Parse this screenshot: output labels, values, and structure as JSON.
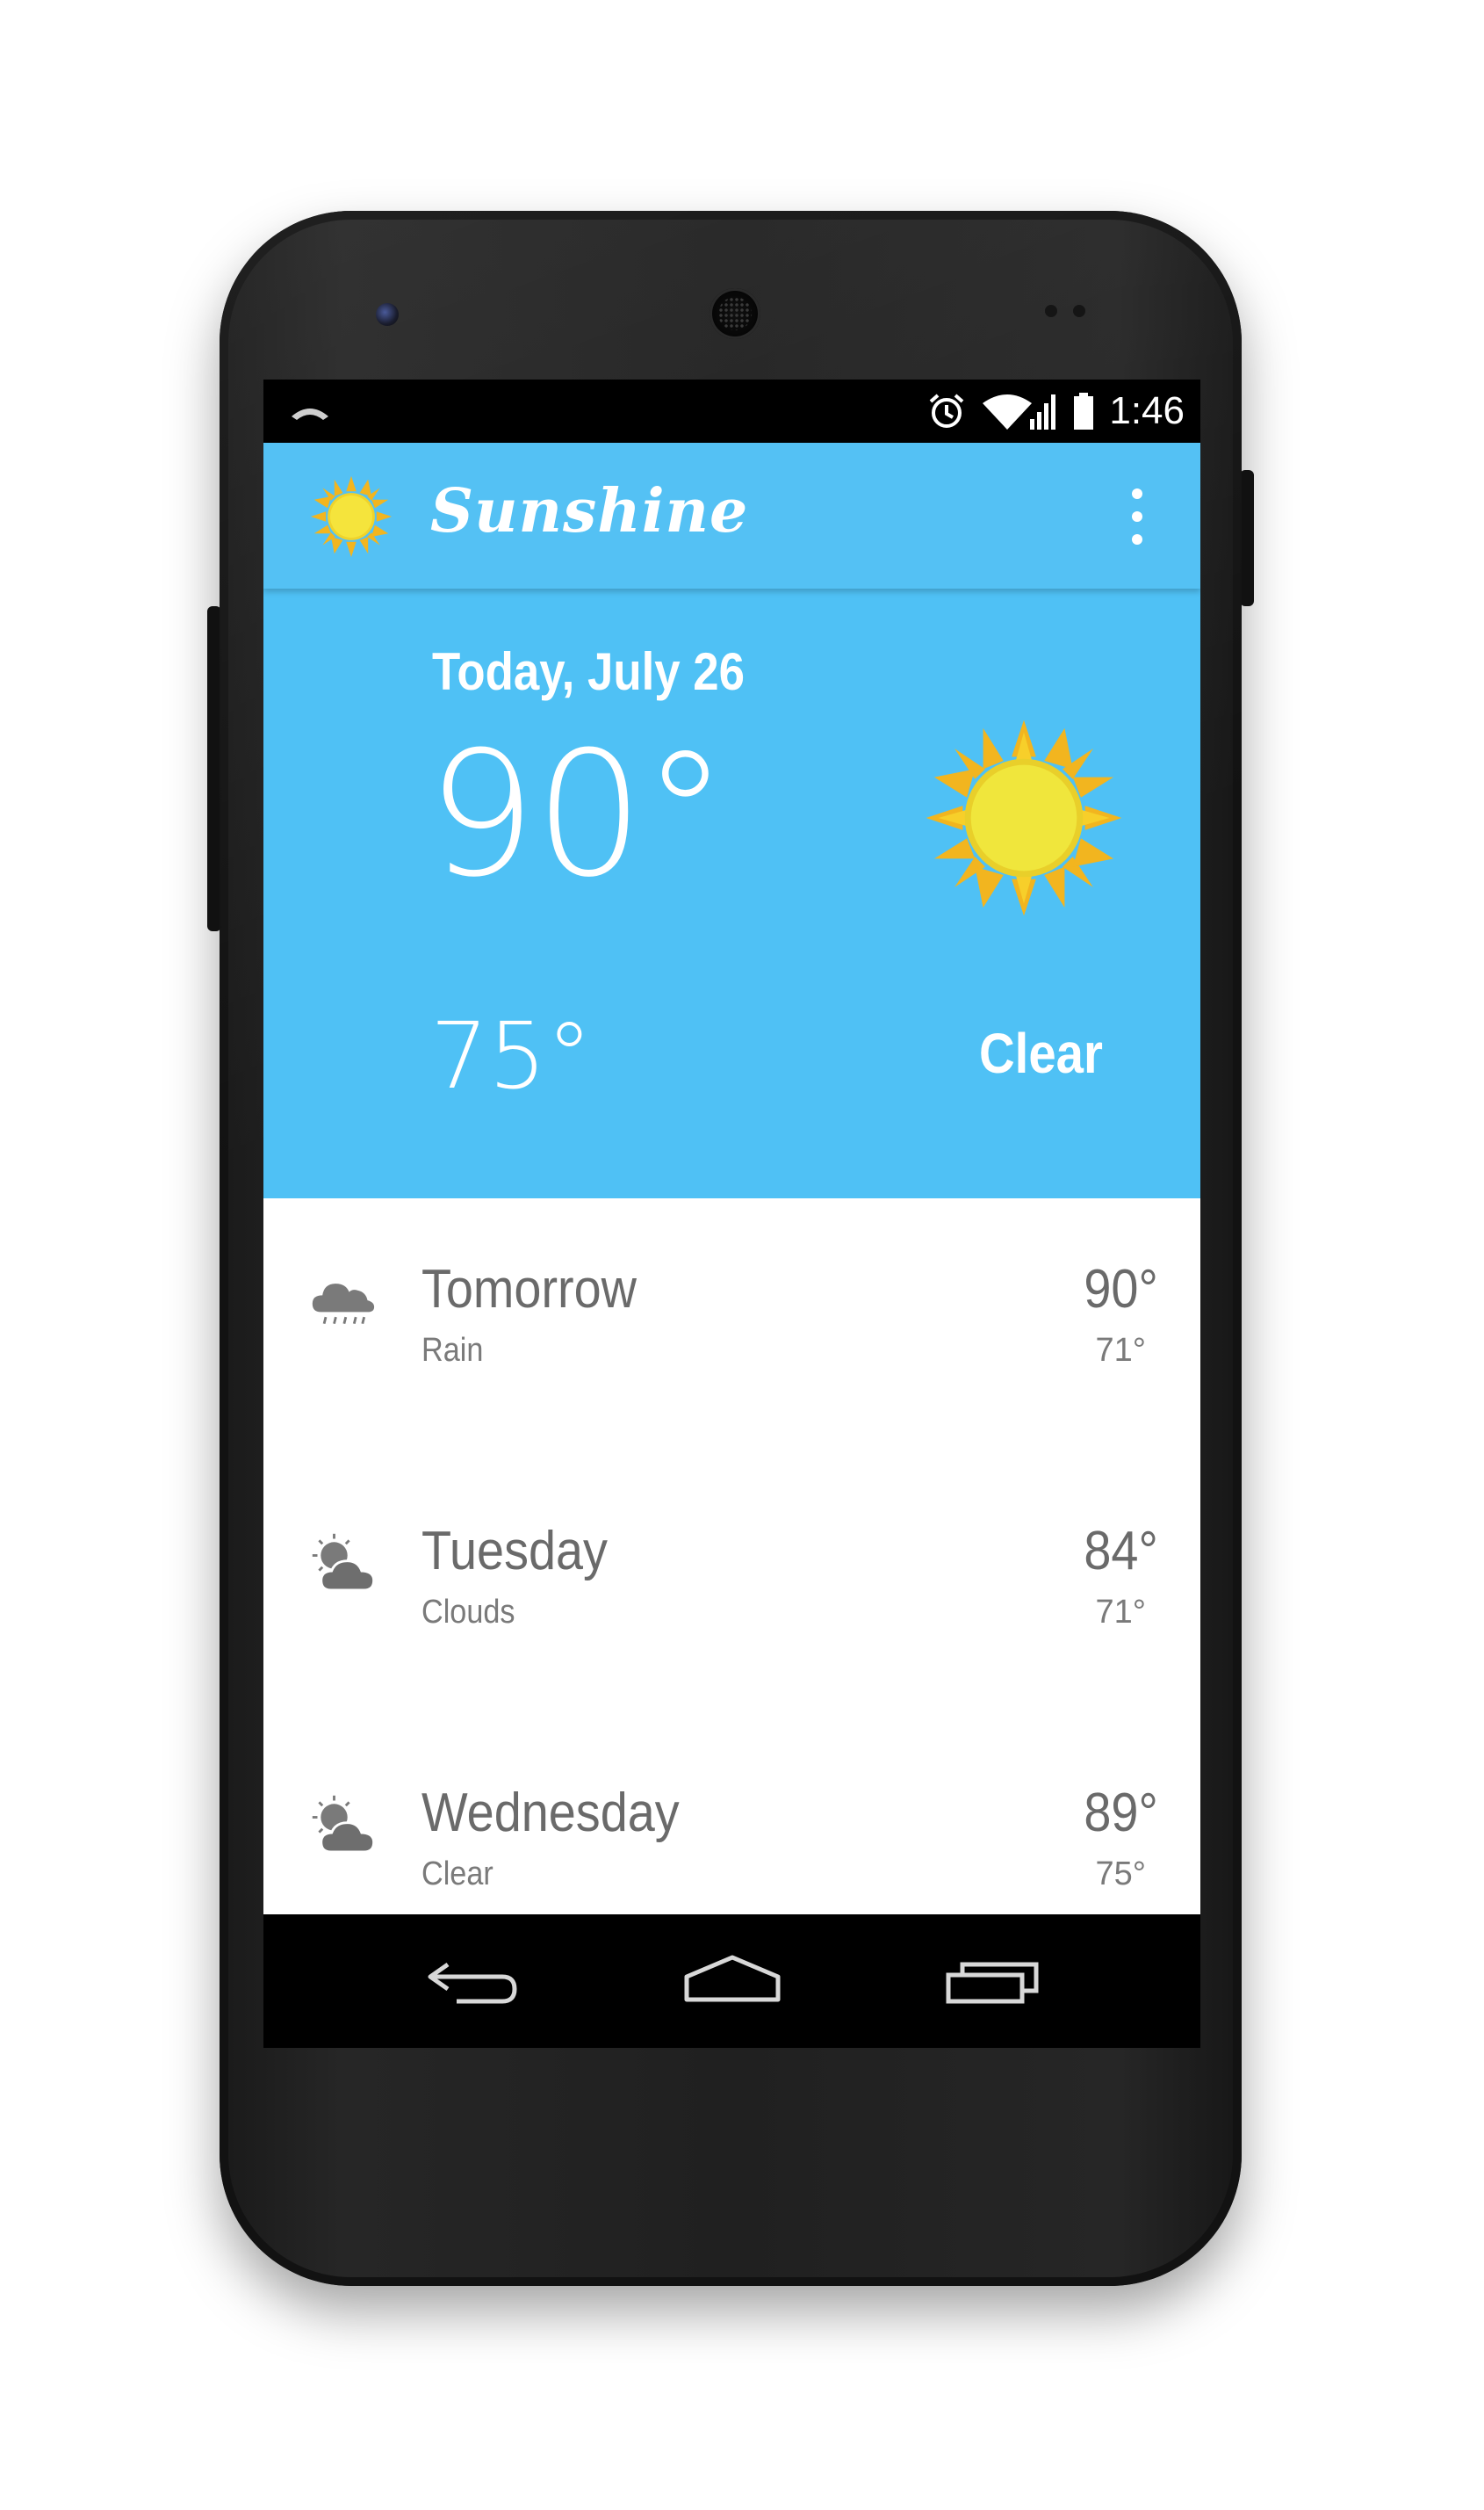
{
  "status_bar": {
    "time": "1:46",
    "icons": [
      "phone-icon",
      "alarm-icon",
      "wifi-icon",
      "signal-icon",
      "battery-icon"
    ]
  },
  "app_bar": {
    "title": "Sunshine",
    "logo": "sun-icon",
    "menu": "overflow-menu-icon"
  },
  "today": {
    "date": "Today, July 26",
    "high": "90°",
    "low": "75°",
    "description": "Clear",
    "icon": "sun-icon"
  },
  "forecast": [
    {
      "day": "Tomorrow",
      "description": "Rain",
      "high": "90°",
      "low": "71°",
      "icon": "rain-icon"
    },
    {
      "day": "Tuesday",
      "description": "Clouds",
      "high": "84°",
      "low": "71°",
      "icon": "partly-cloudy-icon"
    },
    {
      "day": "Wednesday",
      "description": "Clear",
      "high": "89°",
      "low": "75°",
      "icon": "partly-cloudy-icon"
    }
  ],
  "nav_bar": {
    "buttons": [
      "back-icon",
      "home-icon",
      "recents-icon"
    ]
  },
  "colors": {
    "primary": "#54C1F4",
    "today_bg": "#4FC1F5",
    "sun_yellow": "#F5E43C",
    "sun_orange": "#F2B51F",
    "list_text": "#6A6A6A"
  }
}
